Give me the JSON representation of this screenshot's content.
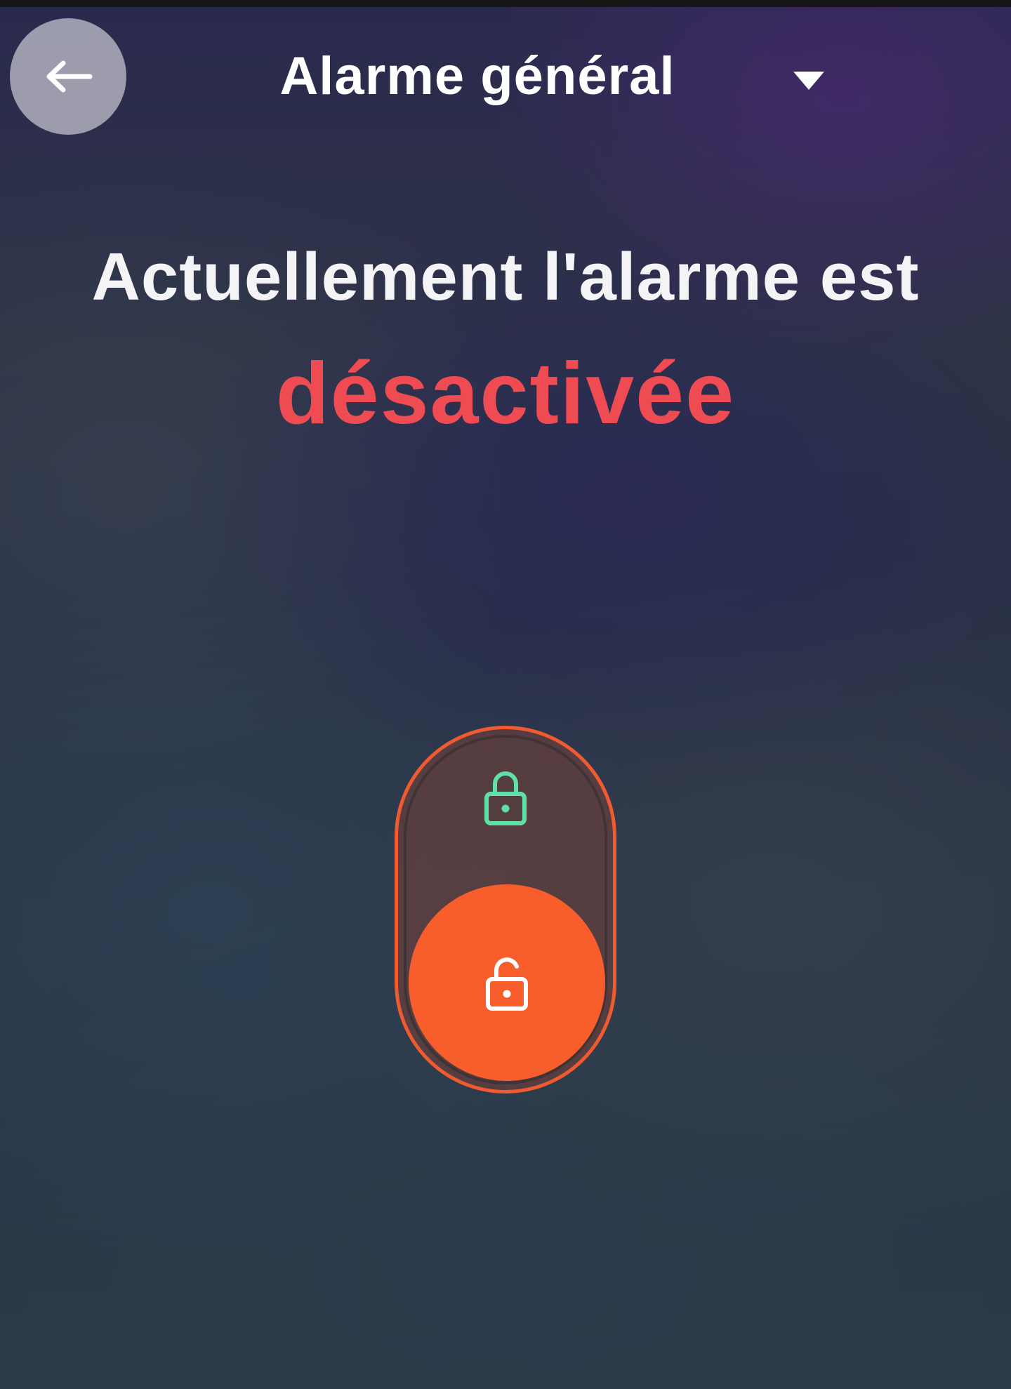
{
  "header": {
    "title": "Alarme général",
    "back_icon": "arrow-left-icon",
    "dropdown_icon": "caret-down-icon"
  },
  "status": {
    "line1": "Actuellement l'alarme est",
    "state": "désactivée",
    "state_color": "#ee4b52"
  },
  "toggle": {
    "armed_icon": "lock-closed-icon",
    "disarmed_icon": "lock-open-icon",
    "armed_icon_color": "#5fe0a4",
    "accent_color": "#f85e2c",
    "selected_position": "disarmed"
  }
}
